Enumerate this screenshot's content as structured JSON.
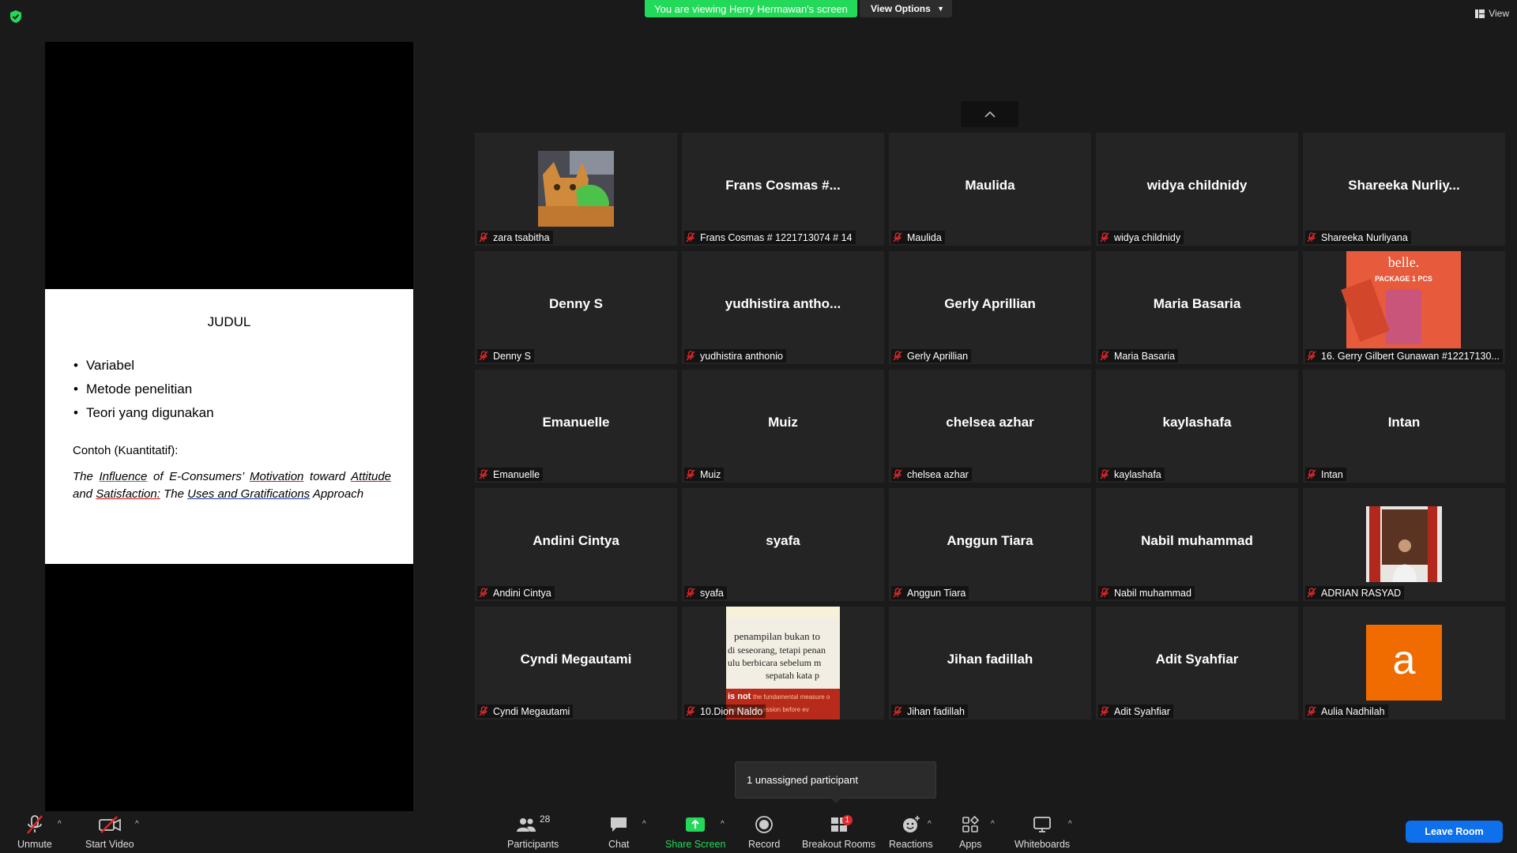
{
  "colors": {
    "background": "#1a1a1a",
    "banner": "#23d959",
    "tile": "#242424",
    "leave": "#0e71eb",
    "mic_muted": "#e02828"
  },
  "topbar": {
    "banner": "You are viewing Herry Hermawan's screen",
    "view_options": "View Options",
    "view": "View"
  },
  "slide": {
    "title": "JUDUL",
    "bullets": [
      "Variabel",
      "Metode penelitian",
      "Teori yang digunakan"
    ],
    "example_label": "Contoh (Kuantitatif):",
    "example_parts": [
      "The",
      "Influence",
      "of E-Consumers’",
      "Motivation",
      "toward",
      "Attitude",
      "and",
      "Satisfaction:",
      "The",
      "Uses and Gratifications",
      "Approach"
    ]
  },
  "participants": [
    {
      "display": "",
      "label": "zara tsabitha",
      "image": "cat-photo"
    },
    {
      "display": "Frans Cosmas #...",
      "label": "Frans Cosmas # 1221713074 # 14"
    },
    {
      "display": "Maulida",
      "label": "Maulida"
    },
    {
      "display": "widya childnidy",
      "label": "widya childnidy"
    },
    {
      "display": "Shareeka  Nurliy...",
      "label": "Shareeka Nurliyana"
    },
    {
      "display": "Denny S",
      "label": "Denny S"
    },
    {
      "display": "yudhistira  antho...",
      "label": "yudhistira anthonio"
    },
    {
      "display": "Gerly Aprillian",
      "label": "Gerly Aprillian"
    },
    {
      "display": "Maria Basaria",
      "label": "Maria Basaria"
    },
    {
      "display": "",
      "label": "16. Gerry Gilbert Gunawan #12217130...",
      "image": "product-photo",
      "image_text": [
        "belle.",
        "PACKAGE 1 PCS"
      ]
    },
    {
      "display": "Emanuelle",
      "label": "Emanuelle"
    },
    {
      "display": "Muiz",
      "label": "Muiz"
    },
    {
      "display": "chelsea azhar",
      "label": "chelsea azhar"
    },
    {
      "display": "kaylashafa",
      "label": "kaylashafa"
    },
    {
      "display": "Intan",
      "label": "Intan"
    },
    {
      "display": "Andini Cintya",
      "label": "Andini Cintya"
    },
    {
      "display": "syafa",
      "label": "syafa"
    },
    {
      "display": "Anggun Tiara",
      "label": "Anggun Tiara"
    },
    {
      "display": "Nabil muhammad",
      "label": "Nabil muhammad"
    },
    {
      "display": "",
      "label": "ADRIAN RASYAD",
      "image": "person-photo"
    },
    {
      "display": "Cyndi Megautami",
      "label": "Cyndi Megautami"
    },
    {
      "display": "",
      "label": "10.Dion Naldo",
      "image": "quote-photo",
      "image_text": [
        "penampilan bukan to",
        "di seseorang, tetapi penan",
        "ulu berbicara sebelum m",
        "sepatah kata p",
        "is not",
        "the fundamental measure o",
        "the first impression before ev"
      ]
    },
    {
      "display": "Jihan fadillah",
      "label": "Jihan fadillah"
    },
    {
      "display": "Adit Syahfiar",
      "label": "Adit Syahfiar"
    },
    {
      "display": "",
      "label": "Aulia Nadhilah",
      "image": "letter-avatar",
      "avatar_letter": "a"
    }
  ],
  "tooltip": "1 unassigned participant",
  "toolbar": {
    "unmute": "Unmute",
    "start_video": "Start Video",
    "participants": "Participants",
    "participants_count": "28",
    "chat": "Chat",
    "share_screen": "Share Screen",
    "record": "Record",
    "breakout_rooms": "Breakout Rooms",
    "breakout_badge": "1",
    "reactions": "Reactions",
    "apps": "Apps",
    "whiteboards": "Whiteboards",
    "leave": "Leave Room"
  }
}
